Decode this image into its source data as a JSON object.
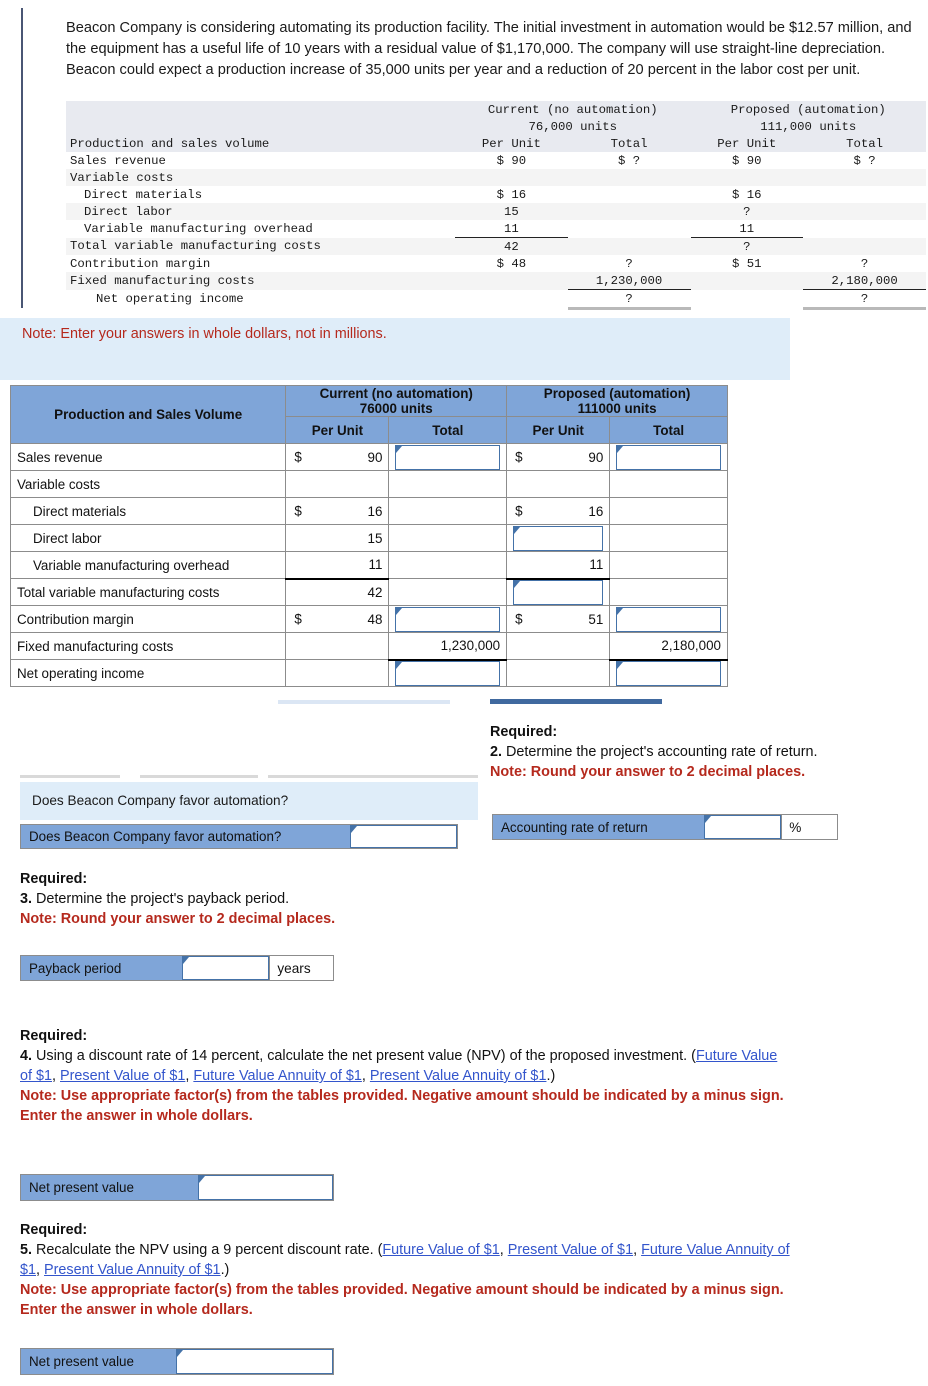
{
  "intro": {
    "paragraph": "Beacon Company is considering automating its production facility. The initial investment in automation would be $12.57 million, and the equipment has a useful life of 10 years with a residual value of $1,170,000. The company will use straight-line depreciation. Beacon could expect a production increase of 35,000 units per year and a reduction of 20 percent in the labor cost per unit."
  },
  "statement": {
    "group_headers": {
      "current_title": "Current (no automation)",
      "current_units": "76,000 units",
      "proposed_title": "Proposed (automation)",
      "proposed_units": "111,000 units"
    },
    "col_headers": {
      "label": "Production and sales volume",
      "cur_per_unit": "Per Unit",
      "cur_total": "Total",
      "prop_per_unit": "Per Unit",
      "prop_total": "Total"
    },
    "rows": [
      {
        "label": "Sales revenue",
        "cur_unit": "$ 90",
        "cur_total": "$ ?",
        "prop_unit": "$ 90",
        "prop_total": "$ ?"
      },
      {
        "label": "Variable costs",
        "cur_unit": "",
        "cur_total": "",
        "prop_unit": "",
        "prop_total": ""
      },
      {
        "label": "Direct materials",
        "cur_unit": "$ 16",
        "cur_total": "",
        "prop_unit": "$ 16",
        "prop_total": ""
      },
      {
        "label": "Direct labor",
        "cur_unit": "15",
        "cur_total": "",
        "prop_unit": "?",
        "prop_total": ""
      },
      {
        "label": "Variable manufacturing overhead",
        "cur_unit": "11",
        "cur_total": "",
        "prop_unit": "11",
        "prop_total": ""
      },
      {
        "label": "Total variable manufacturing costs",
        "cur_unit": "42",
        "cur_total": "",
        "prop_unit": "?",
        "prop_total": ""
      },
      {
        "label": "Contribution margin",
        "cur_unit": "$ 48",
        "cur_total": "?",
        "prop_unit": "$ 51",
        "prop_total": "?"
      },
      {
        "label": "Fixed manufacturing costs",
        "cur_unit": "",
        "cur_total": "1,230,000",
        "prop_unit": "",
        "prop_total": "2,180,000"
      },
      {
        "label": "Net operating income",
        "cur_unit": "",
        "cur_total": "?",
        "prop_unit": "",
        "prop_total": "?"
      }
    ]
  },
  "note_banner": {
    "text": "Note: Enter your answers in whole dollars, not in millions."
  },
  "grid": {
    "headers": {
      "current_title": "Current (no automation)",
      "current_units": "76000 units",
      "proposed_title": "Proposed (automation)",
      "proposed_units": "111000 units",
      "label": "Production and Sales Volume",
      "cur_per_unit": "Per Unit",
      "cur_total": "Total",
      "prop_per_unit": "Per Unit",
      "prop_total": "Total"
    },
    "rows": [
      {
        "label": "Sales revenue",
        "cur_unit_dollar": "$",
        "cur_unit": "90",
        "cur_total_input": true,
        "cur_total": "",
        "prop_unit_dollar": "$",
        "prop_unit": "90",
        "prop_total_input": true,
        "prop_total": ""
      },
      {
        "label": "Variable costs",
        "cur_unit_dollar": "",
        "cur_unit": "",
        "cur_total_input": false,
        "cur_total": "",
        "prop_unit_dollar": "",
        "prop_unit": "",
        "prop_total_input": false,
        "prop_total": ""
      },
      {
        "label": "Direct materials",
        "cur_unit_dollar": "$",
        "cur_unit": "16",
        "cur_total_input": false,
        "cur_total": "",
        "prop_unit_dollar": "$",
        "prop_unit": "16",
        "prop_total_input": false,
        "prop_total": ""
      },
      {
        "label": "Direct labor",
        "cur_unit_dollar": "",
        "cur_unit": "15",
        "cur_total_input": false,
        "cur_total": "",
        "prop_unit_dollar": "",
        "prop_unit": "",
        "prop_total_input": false,
        "prop_total": "",
        "prop_unit_input": true
      },
      {
        "label": "Variable manufacturing overhead",
        "cur_unit_dollar": "",
        "cur_unit": "11",
        "cur_total_input": false,
        "cur_total": "",
        "prop_unit_dollar": "",
        "prop_unit": "11",
        "prop_total_input": false,
        "prop_total": ""
      },
      {
        "label": "Total variable manufacturing costs",
        "cur_unit_dollar": "",
        "cur_unit": "42",
        "cur_total_input": false,
        "cur_total": "",
        "prop_unit_dollar": "",
        "prop_unit": "",
        "prop_total_input": false,
        "prop_total": "",
        "prop_unit_input": true
      },
      {
        "label": "Contribution margin",
        "cur_unit_dollar": "$",
        "cur_unit": "48",
        "cur_total_input": true,
        "cur_total": "",
        "prop_unit_dollar": "$",
        "prop_unit": "51",
        "prop_total_input": true,
        "prop_total": ""
      },
      {
        "label": "Fixed manufacturing costs",
        "cur_unit_dollar": "",
        "cur_unit": "",
        "cur_total_input": false,
        "cur_total": "1,230,000",
        "prop_unit_dollar": "",
        "prop_unit": "",
        "prop_total_input": false,
        "prop_total": "2,180,000"
      },
      {
        "label": "Net operating income",
        "cur_unit_dollar": "",
        "cur_unit": "",
        "cur_total_input": true,
        "cur_total": "",
        "prop_unit_dollar": "",
        "prop_unit": "",
        "prop_total_input": true,
        "prop_total": ""
      }
    ]
  },
  "favor_question": {
    "banner_text": "Does Beacon Company favor automation?",
    "label": "Does Beacon Company favor automation?",
    "value": ""
  },
  "req2": {
    "heading": "Required:",
    "number": "2.",
    "text": "Determine the project's accounting rate of return.",
    "note": "Note: Round your answer to 2 decimal places.",
    "label": "Accounting rate of return",
    "value": "",
    "suffix": "%"
  },
  "req3": {
    "heading": "Required:",
    "number": "3.",
    "text": "Determine the project's payback period.",
    "note": "Note: Round your answer to 2 decimal places.",
    "label": "Payback period",
    "value": "",
    "suffix": "years"
  },
  "req4": {
    "heading": "Required:",
    "number": "4.",
    "text_a": "Using a discount rate of 14 percent, calculate the net present value (NPV) of the proposed investment. (",
    "link1": "Future Value of $1",
    "link2": "Present Value of $1",
    "link3": "Future Value Annuity of $1",
    "link4": "Present Value Annuity of $1",
    "text_b": ".)",
    "note": "Note: Use appropriate factor(s) from the tables provided. Negative amount should be indicated by a minus sign. Enter the answer in whole dollars.",
    "label": "Net present value",
    "value": ""
  },
  "req5": {
    "heading": "Required:",
    "number": "5.",
    "text_a": "Recalculate the NPV using a 9 percent discount rate. (",
    "link1": "Future Value of $1",
    "link2": "Present Value of $1",
    "link3": "Future Value Annuity of $1",
    "link4": "Present Value Annuity of $1",
    "text_b": ".)",
    "note": "Note: Use appropriate factor(s) from the tables provided. Negative amount should be indicated by a minus sign. Enter the answer in whole dollars.",
    "label": "Net present value",
    "value": ""
  },
  "colors": {
    "header_blue": "#7fa5d8",
    "banner_blue": "#dfedf9",
    "note_red": "#b5291d",
    "link_blue": "#3355cc",
    "input_border": "#4472a8"
  }
}
